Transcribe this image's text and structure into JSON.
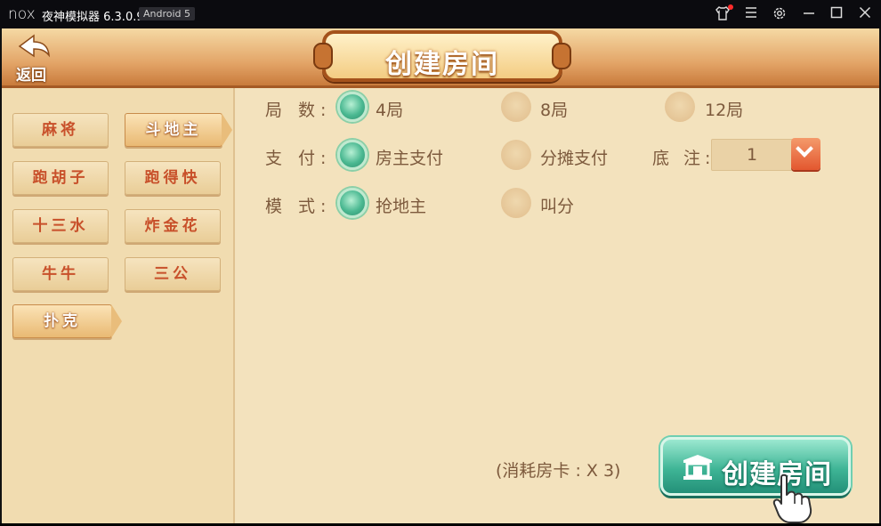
{
  "window": {
    "logo_text": "nox",
    "title": "夜神模拟器 6.3.0.9",
    "android_badge": "Android 5",
    "icons": [
      "shirt-icon",
      "menu-icon",
      "settings-icon",
      "minimize-icon",
      "maximize-icon",
      "close-icon"
    ]
  },
  "header": {
    "back_label": "返回",
    "title": "创建房间"
  },
  "categories": {
    "left_column": [
      "麻将",
      "跑胡子",
      "十三水",
      "牛牛",
      "扑克"
    ],
    "right_column": [
      "斗地主",
      "跑得快",
      "炸金花",
      "三公"
    ],
    "active": [
      "扑克",
      "斗地主"
    ]
  },
  "options": {
    "rounds": {
      "label": "局 数:",
      "choices": [
        "4局",
        "8局",
        "12局"
      ],
      "selected": "4局"
    },
    "payment": {
      "label": "支 付:",
      "choices": [
        "房主支付",
        "分摊支付"
      ],
      "selected": "房主支付"
    },
    "bet": {
      "label": "底 注:",
      "value": "1"
    },
    "mode": {
      "label": "模 式:",
      "choices": [
        "抢地主",
        "叫分"
      ],
      "selected": "抢地主"
    }
  },
  "footer": {
    "cost_text": "(消耗房卡 : X 3)",
    "create_label": "创建房间"
  },
  "colors": {
    "accent_green": "#3fb596",
    "text_brown": "#7d5a3d",
    "category_red": "#c8502a",
    "header_orange": "#e3a568"
  }
}
